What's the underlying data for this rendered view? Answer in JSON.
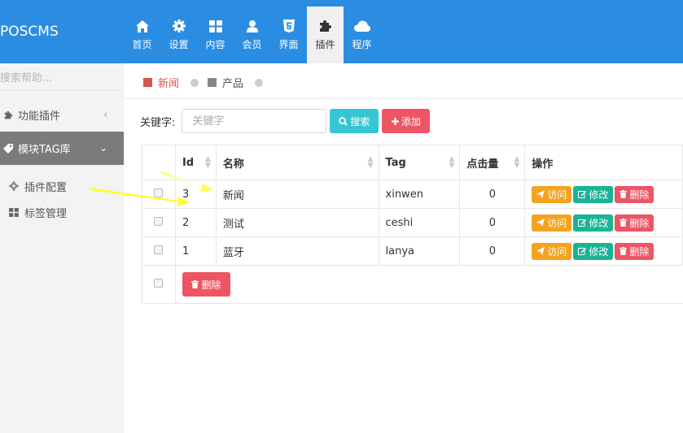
{
  "app": {
    "brand": "POSCMS"
  },
  "topnav": {
    "items": [
      {
        "label": "首页",
        "icon": "home-icon"
      },
      {
        "label": "设置",
        "icon": "gear-icon"
      },
      {
        "label": "内容",
        "icon": "grid-icon"
      },
      {
        "label": "会员",
        "icon": "user-icon"
      },
      {
        "label": "界面",
        "icon": "html5-icon"
      },
      {
        "label": "插件",
        "icon": "puzzle-icon",
        "active": true
      },
      {
        "label": "程序",
        "icon": "cloud-icon"
      }
    ]
  },
  "sidebar": {
    "search_placeholder": "搜索帮助...",
    "items": [
      {
        "label": "功能插件",
        "icon": "puzzle-icon",
        "arrow": "‹"
      },
      {
        "label": "模块TAG库",
        "icon": "tag-icon",
        "arrow": "⌄",
        "active": true
      }
    ],
    "sub_items": [
      {
        "label": "插件配置",
        "icon": "gear-icon"
      },
      {
        "label": "标签管理",
        "icon": "grid-icon"
      }
    ]
  },
  "tabs": {
    "items": [
      {
        "label": "新闻",
        "color": "#d9534f",
        "active": true
      },
      {
        "label": "产品",
        "color": "#888888"
      }
    ]
  },
  "toolbar": {
    "keyword_label": "关键字:",
    "keyword_placeholder": "关键字",
    "search_label": "搜索",
    "add_label": "添加"
  },
  "table": {
    "headers": [
      "Id",
      "名称",
      "Tag",
      "点击量",
      "操作"
    ],
    "rows": [
      {
        "id": "3",
        "name": "新闻",
        "tag": "xinwen",
        "hits": "0"
      },
      {
        "id": "2",
        "name": "测试",
        "tag": "ceshi",
        "hits": "0"
      },
      {
        "id": "1",
        "name": "蓝牙",
        "tag": "lanya",
        "hits": "0"
      }
    ],
    "actions": {
      "visit": "访问",
      "edit": "修改",
      "delete": "删除"
    },
    "bulk_delete_label": "删除"
  },
  "colors": {
    "header_bg": "#2b8de2",
    "sidebar_bg": "#f3f3f4",
    "sidebar_active": "#7b7b7b",
    "search_btn": "#36c6d3",
    "danger": "#ed5565",
    "warning": "#f3a320",
    "success": "#1ab394",
    "annotation_arrow": "#ffff33"
  }
}
